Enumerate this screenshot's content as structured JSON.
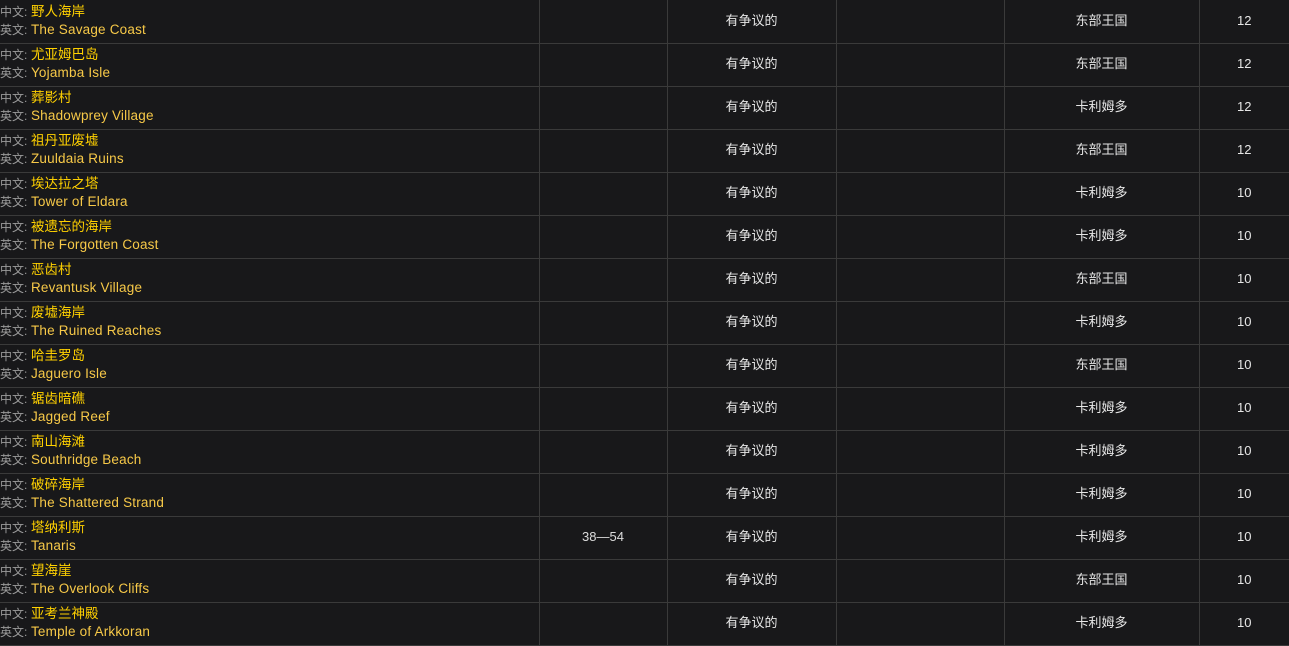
{
  "table": {
    "labels": {
      "zh_label": "中文:",
      "en_label": "英文:"
    },
    "rows": [
      {
        "zh": "野人海岸",
        "en": "The Savage Coast",
        "level": "",
        "status": "有争议的",
        "blank": "",
        "continent": "东部王国",
        "num": "12"
      },
      {
        "zh": "尤亚姆巴岛",
        "en": "Yojamba Isle",
        "level": "",
        "status": "有争议的",
        "blank": "",
        "continent": "东部王国",
        "num": "12"
      },
      {
        "zh": "葬影村",
        "en": "Shadowprey Village",
        "level": "",
        "status": "有争议的",
        "blank": "",
        "continent": "卡利姆多",
        "num": "12"
      },
      {
        "zh": "祖丹亚废墟",
        "en": "Zuuldaia Ruins",
        "level": "",
        "status": "有争议的",
        "blank": "",
        "continent": "东部王国",
        "num": "12"
      },
      {
        "zh": "埃达拉之塔",
        "en": "Tower of Eldara",
        "level": "",
        "status": "有争议的",
        "blank": "",
        "continent": "卡利姆多",
        "num": "10"
      },
      {
        "zh": "被遗忘的海岸",
        "en": "The Forgotten Coast",
        "level": "",
        "status": "有争议的",
        "blank": "",
        "continent": "卡利姆多",
        "num": "10"
      },
      {
        "zh": "恶齿村",
        "en": "Revantusk Village",
        "level": "",
        "status": "有争议的",
        "blank": "",
        "continent": "东部王国",
        "num": "10"
      },
      {
        "zh": "废墟海岸",
        "en": "The Ruined Reaches",
        "level": "",
        "status": "有争议的",
        "blank": "",
        "continent": "卡利姆多",
        "num": "10"
      },
      {
        "zh": "哈圭罗岛",
        "en": "Jaguero Isle",
        "level": "",
        "status": "有争议的",
        "blank": "",
        "continent": "东部王国",
        "num": "10"
      },
      {
        "zh": "锯齿暗礁",
        "en": "Jagged Reef",
        "level": "",
        "status": "有争议的",
        "blank": "",
        "continent": "卡利姆多",
        "num": "10"
      },
      {
        "zh": "南山海滩",
        "en": "Southridge Beach",
        "level": "",
        "status": "有争议的",
        "blank": "",
        "continent": "卡利姆多",
        "num": "10"
      },
      {
        "zh": "破碎海岸",
        "en": "The Shattered Strand",
        "level": "",
        "status": "有争议的",
        "blank": "",
        "continent": "卡利姆多",
        "num": "10"
      },
      {
        "zh": "塔纳利斯",
        "en": "Tanaris",
        "level": "38—54",
        "status": "有争议的",
        "blank": "",
        "continent": "卡利姆多",
        "num": "10"
      },
      {
        "zh": "望海崖",
        "en": "The Overlook Cliffs",
        "level": "",
        "status": "有争议的",
        "blank": "",
        "continent": "东部王国",
        "num": "10"
      },
      {
        "zh": "亚考兰神殿",
        "en": "Temple of Arkkoran",
        "level": "",
        "status": "有争议的",
        "blank": "",
        "continent": "卡利姆多",
        "num": "10"
      }
    ]
  },
  "colors": {
    "background": "#18181a",
    "grid": "#3a3a3a",
    "name_zh": "#ffd100",
    "name_en": "#f7c948",
    "label": "#9b9b9b",
    "text": "#e6e6e6"
  }
}
